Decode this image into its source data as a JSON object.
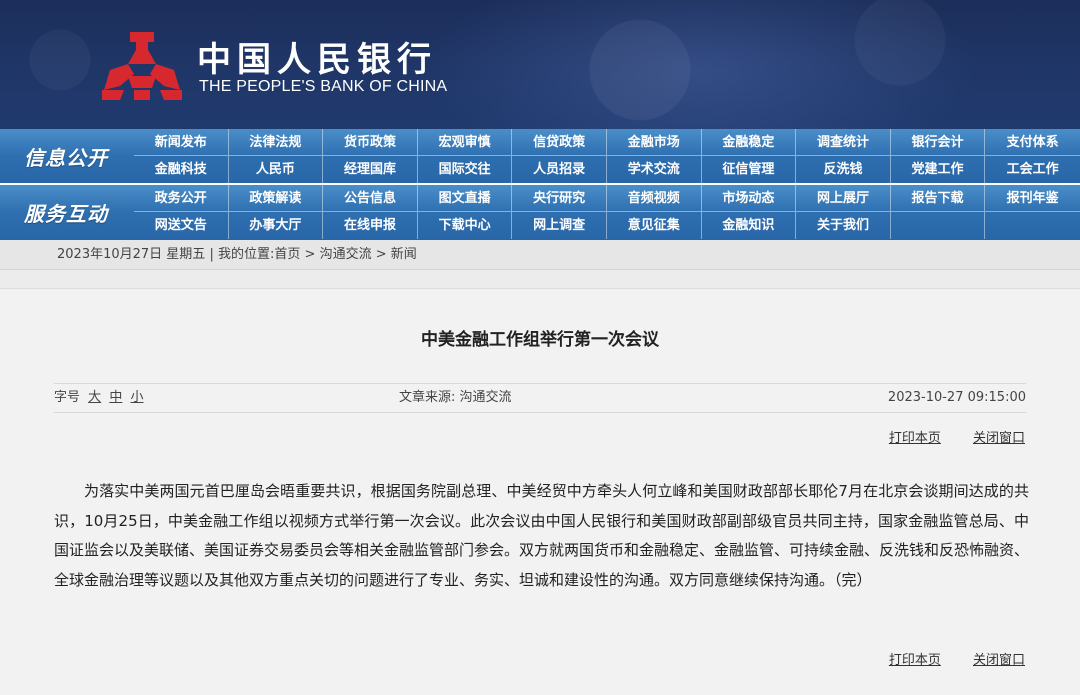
{
  "header": {
    "bank_name_cn": "中国人民银行",
    "bank_name_en": "THE PEOPLE'S BANK OF CHINA",
    "logo_icon": "pboc-logo-icon",
    "logo_color": "#d8282f"
  },
  "nav": {
    "section1_title": "信息公开",
    "section2_title": "服务互动",
    "row1": [
      "新闻发布",
      "法律法规",
      "货币政策",
      "宏观审慎",
      "信贷政策",
      "金融市场",
      "金融稳定",
      "调查统计",
      "银行会计",
      "支付体系"
    ],
    "row2": [
      "金融科技",
      "人民币",
      "经理国库",
      "国际交往",
      "人员招录",
      "学术交流",
      "征信管理",
      "反洗钱",
      "党建工作",
      "工会工作"
    ],
    "row3": [
      "政务公开",
      "政策解读",
      "公告信息",
      "图文直播",
      "央行研究",
      "音频视频",
      "市场动态",
      "网上展厅",
      "报告下载",
      "报刊年鉴"
    ],
    "row4": [
      "网送文告",
      "办事大厅",
      "在线申报",
      "下载中心",
      "网上调查",
      "意见征集",
      "金融知识",
      "关于我们",
      "",
      ""
    ]
  },
  "breadcrumb": {
    "date": "2023年10月27日 星期五",
    "location_label": "我的位置:",
    "home": "首页",
    "sep": ">",
    "level1": "沟通交流",
    "level2": "新闻"
  },
  "article": {
    "title": "中美金融工作组举行第一次会议",
    "font_size_label": "字号",
    "size_large": "大",
    "size_medium": "中",
    "size_small": "小",
    "source_label": "文章来源:",
    "source": "沟通交流",
    "datetime": "2023-10-27 09:15:00",
    "print_label": "打印本页",
    "close_label": "关闭窗口",
    "body": "为落实中美两国元首巴厘岛会晤重要共识，根据国务院副总理、中美经贸中方牵头人何立峰和美国财政部部长耶伦7月在北京会谈期间达成的共识，10月25日，中美金融工作组以视频方式举行第一次会议。此次会议由中国人民银行和美国财政部副部级官员共同主持，国家金融监管总局、中国证监会以及美联储、美国证券交易委员会等相关金融监管部门参会。双方就两国货币和金融稳定、金融监管、可持续金融、反洗钱和反恐怖融资、全球金融治理等议题以及其他双方重点关切的问题进行了专业、务实、坦诚和建设性的沟通。双方同意继续保持沟通。（完）"
  }
}
